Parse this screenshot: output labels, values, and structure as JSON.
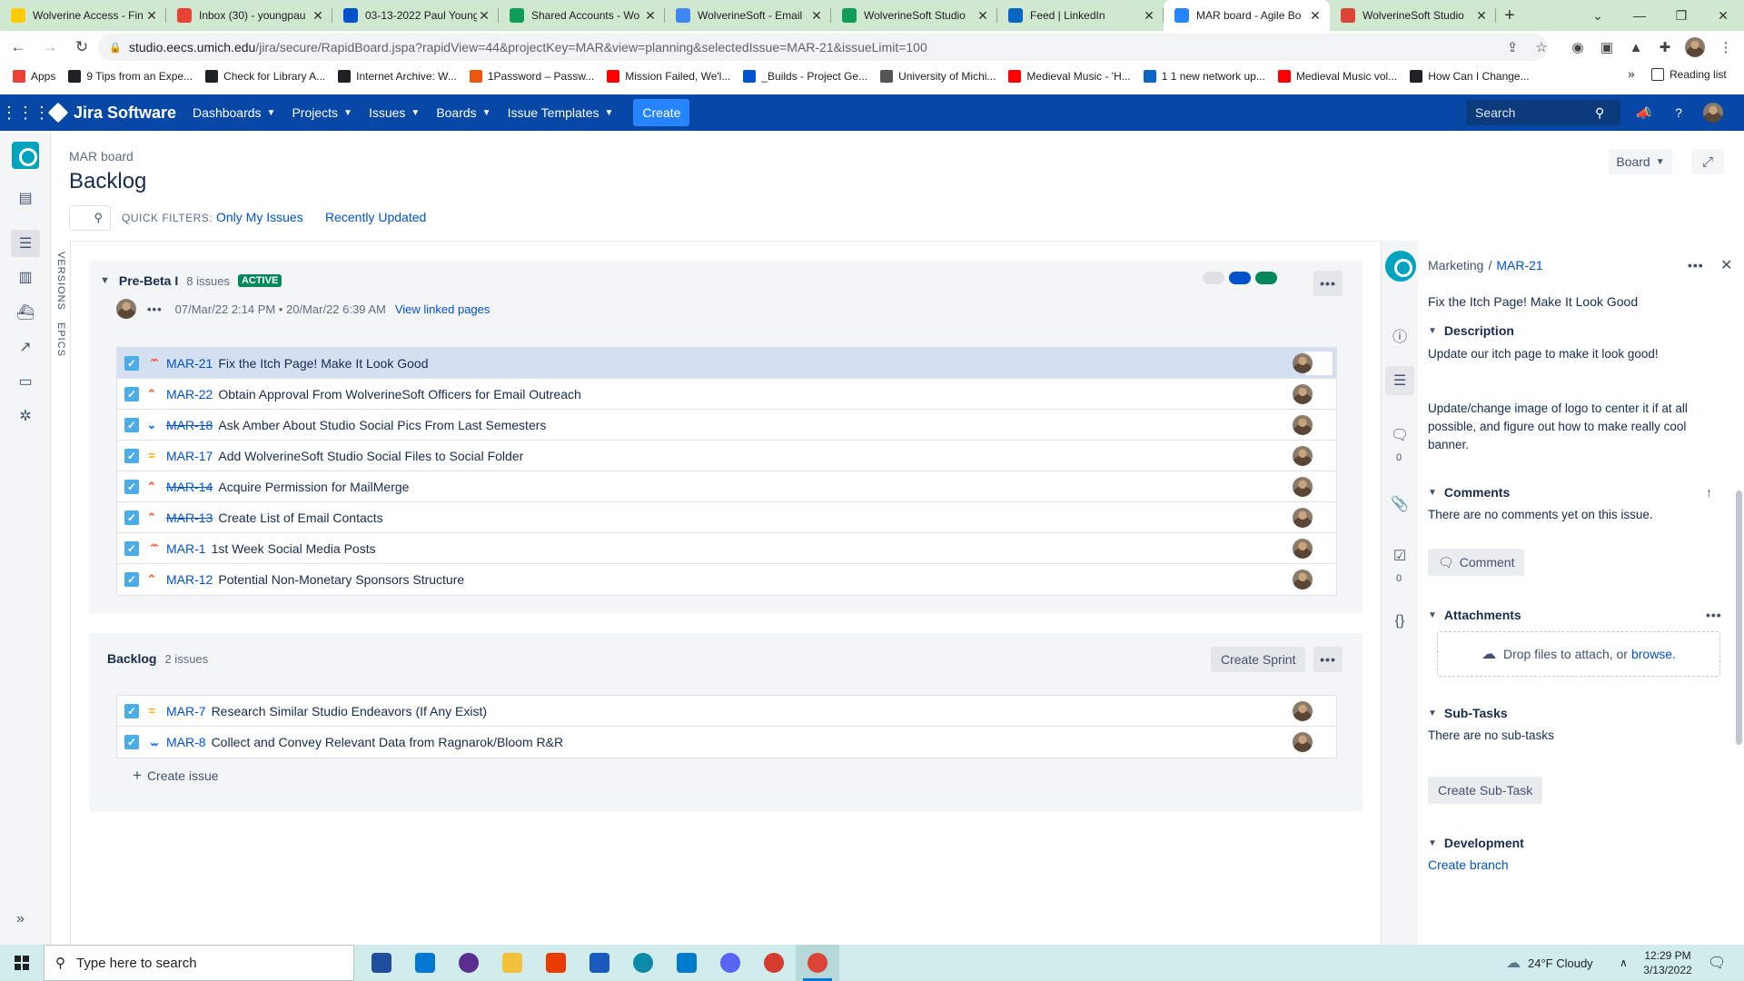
{
  "browser": {
    "tabs": [
      {
        "title": "Wolverine Access - Fin",
        "icon": "m-logo-icon",
        "color": "#ffcb05",
        "active": false
      },
      {
        "title": "Inbox (30) - youngpau",
        "icon": "gmail-icon",
        "color": "#ea4335",
        "active": false
      },
      {
        "title": "03-13-2022 Paul Young",
        "icon": "confluence-icon",
        "color": "#0052cc",
        "active": false
      },
      {
        "title": "Shared Accounts - Wo",
        "icon": "drive-icon",
        "color": "#0f9d58",
        "active": false
      },
      {
        "title": "WolverineSoft - Email",
        "icon": "docs-icon",
        "color": "#4285f4",
        "active": false
      },
      {
        "title": "WolverineSoft Studio",
        "icon": "sheets-icon",
        "color": "#0f9d58",
        "active": false
      },
      {
        "title": "Feed | LinkedIn",
        "icon": "linkedin-icon",
        "color": "#0a66c2",
        "active": false
      },
      {
        "title": "MAR board - Agile Bo",
        "icon": "jira-icon",
        "color": "#2684ff",
        "active": true
      },
      {
        "title": "WolverineSoft Studio",
        "icon": "calendar-icon",
        "color": "#db4437",
        "active": false
      }
    ],
    "url_host": "studio.eecs.umich.edu",
    "url_path": "/jira/secure/RapidBoard.jspa?rapidView=44&projectKey=MAR&view=planning&selectedIssue=MAR-21&issueLimit=100",
    "bookmarks": [
      {
        "label": "Apps",
        "color": "#ea4335"
      },
      {
        "label": "9 Tips from an Expe...",
        "color": "#202124"
      },
      {
        "label": "Check for Library A...",
        "color": "#202124"
      },
      {
        "label": "Internet Archive: W...",
        "color": "#202124"
      },
      {
        "label": "1Password – Passw...",
        "color": "#e8580c"
      },
      {
        "label": "Mission Failed, We'l...",
        "color": "#ff0000"
      },
      {
        "label": "_Builds - Project Ge...",
        "color": "#0052cc"
      },
      {
        "label": "University of Michi...",
        "color": "#555555"
      },
      {
        "label": "Medieval Music - 'H...",
        "color": "#ff0000"
      },
      {
        "label": "1 1 new network up...",
        "color": "#0a66c2"
      },
      {
        "label": "Medieval Music vol...",
        "color": "#ff0000"
      },
      {
        "label": "How Can I Change...",
        "color": "#202124"
      }
    ],
    "reading_list": "Reading list"
  },
  "jira_nav": {
    "product": "Jira Software",
    "menus": [
      "Dashboards",
      "Projects",
      "Issues",
      "Boards",
      "Issue Templates"
    ],
    "create": "Create",
    "search_placeholder": "Search"
  },
  "header": {
    "breadcrumb": "MAR board",
    "title": "Backlog",
    "quick_filters_label": "QUICK FILTERS:",
    "filters": [
      "Only My Issues",
      "Recently Updated"
    ],
    "board_button": "Board"
  },
  "rail": {
    "versions": "VERSIONS",
    "epics": "EPICS"
  },
  "sprint": {
    "name": "Pre-Beta I",
    "count": "8 issues",
    "status": "ACTIVE",
    "dates": "07/Mar/22 2:14 PM • 20/Mar/22 6:39 AM",
    "linked_pages": "View linked pages",
    "status_colors": [
      "#dfe1e6",
      "#0052cc",
      "#00875a"
    ],
    "issues": [
      {
        "key": "MAR-21",
        "summary": "Fix the Itch Page! Make It Look Good",
        "priority": "highest",
        "done": false,
        "selected": true
      },
      {
        "key": "MAR-22",
        "summary": "Obtain Approval From WolverineSoft Officers for Email Outreach",
        "priority": "high",
        "done": false,
        "selected": false
      },
      {
        "key": "MAR-18",
        "summary": "Ask Amber About Studio Social Pics From Last Semesters",
        "priority": "low",
        "done": true,
        "selected": false
      },
      {
        "key": "MAR-17",
        "summary": "Add WolverineSoft Studio Social Files to Social Folder",
        "priority": "medium",
        "done": false,
        "selected": false
      },
      {
        "key": "MAR-14",
        "summary": "Acquire Permission for MailMerge",
        "priority": "high",
        "done": true,
        "selected": false
      },
      {
        "key": "MAR-13",
        "summary": "Create List of Email Contacts",
        "priority": "high",
        "done": true,
        "selected": false
      },
      {
        "key": "MAR-1",
        "summary": "1st Week Social Media Posts",
        "priority": "highest",
        "done": false,
        "selected": false
      },
      {
        "key": "MAR-12",
        "summary": "Potential Non-Monetary Sponsors Structure",
        "priority": "high",
        "done": false,
        "selected": false
      }
    ]
  },
  "backlog": {
    "name": "Backlog",
    "count": "2 issues",
    "create_sprint": "Create Sprint",
    "create_issue": "Create issue",
    "issues": [
      {
        "key": "MAR-7",
        "summary": "Research Similar Studio Endeavors (If Any Exist)",
        "priority": "medium",
        "done": false,
        "selected": false
      },
      {
        "key": "MAR-8",
        "summary": "Collect and Convey Relevant Data from Ragnarok/Bloom R&R",
        "priority": "lowest",
        "done": false,
        "selected": false
      }
    ]
  },
  "detail": {
    "project": "Marketing",
    "separator": "/",
    "key": "MAR-21",
    "summary": "Fix the Itch Page! Make It Look Good",
    "description_heading": "Description",
    "description_1": "Update our itch page to make it look good!",
    "description_2": "Update/change image of logo to center it if at all possible, and figure out how to make really cool banner.",
    "comments_heading": "Comments",
    "comments_empty": "There are no comments yet on this issue.",
    "comment_button": "Comment",
    "attachments_heading": "Attachments",
    "drop_text": "Drop files to attach, or",
    "browse_link": "browse.",
    "subtasks_heading": "Sub-Tasks",
    "subtasks_empty": "There are no sub-tasks",
    "create_subtask": "Create Sub-Task",
    "development_heading": "Development",
    "create_branch": "Create branch",
    "comment_count": "0",
    "checklist_count": "0"
  },
  "taskbar": {
    "search_placeholder": "Type here to search",
    "weather": "24°F  Cloudy",
    "time": "12:29 PM",
    "date": "3/13/2022",
    "apps": [
      {
        "name": "calculator-icon",
        "color": "#1f4e9c"
      },
      {
        "name": "mail-icon",
        "color": "#0078d4"
      },
      {
        "name": "obs-icon",
        "color": "#5b2d8e"
      },
      {
        "name": "file-explorer-icon",
        "color": "#f3c13a"
      },
      {
        "name": "office-icon",
        "color": "#eb3c00"
      },
      {
        "name": "word-icon",
        "color": "#185abd"
      },
      {
        "name": "edge-icon",
        "color": "#0c8aa8"
      },
      {
        "name": "vscode-icon",
        "color": "#007acc"
      },
      {
        "name": "discord-icon",
        "color": "#5865f2"
      },
      {
        "name": "app-red-icon",
        "color": "#d63b2f"
      },
      {
        "name": "chrome-icon",
        "color": "#db4437"
      }
    ]
  }
}
